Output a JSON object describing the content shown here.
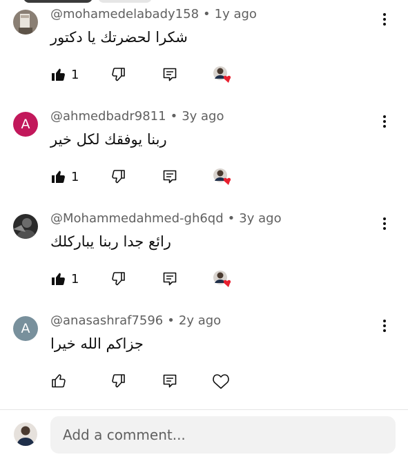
{
  "comments": [
    {
      "handle": "@mohamedelabady158",
      "age": "1y ago",
      "text": "شكرا لحضرتك يا دكتور",
      "likes": "1",
      "avatar_letter": "",
      "avatar_color": "#8a7f74",
      "liked_by_creator": true
    },
    {
      "handle": "@ahmedbadr9811",
      "age": "3y ago",
      "text": "ربنا يوفقك لكل خير",
      "likes": "1",
      "avatar_letter": "A",
      "avatar_color": "#c2185b",
      "liked_by_creator": true
    },
    {
      "handle": "@Mohammedahmed-gh6qd",
      "age": "3y ago",
      "text": "رائع جدا ربنا يباركلك",
      "likes": "1",
      "avatar_letter": "",
      "avatar_color": "#2b2b2b",
      "liked_by_creator": true
    },
    {
      "handle": "@anasashraf7596",
      "age": "2y ago",
      "text": "جزاكم الله خيرا",
      "likes": "",
      "avatar_letter": "A",
      "avatar_color": "#78909c",
      "liked_by_creator": false
    }
  ],
  "separator": "•",
  "composer": {
    "placeholder": "Add a comment..."
  },
  "colors": {
    "heart": "#e8202f",
    "muted": "#606060",
    "input_bg": "#f2f2f2"
  },
  "icons": [
    "thumbs-up-icon",
    "thumbs-down-icon",
    "reply-icon",
    "heart-icon",
    "more-vert-icon"
  ]
}
